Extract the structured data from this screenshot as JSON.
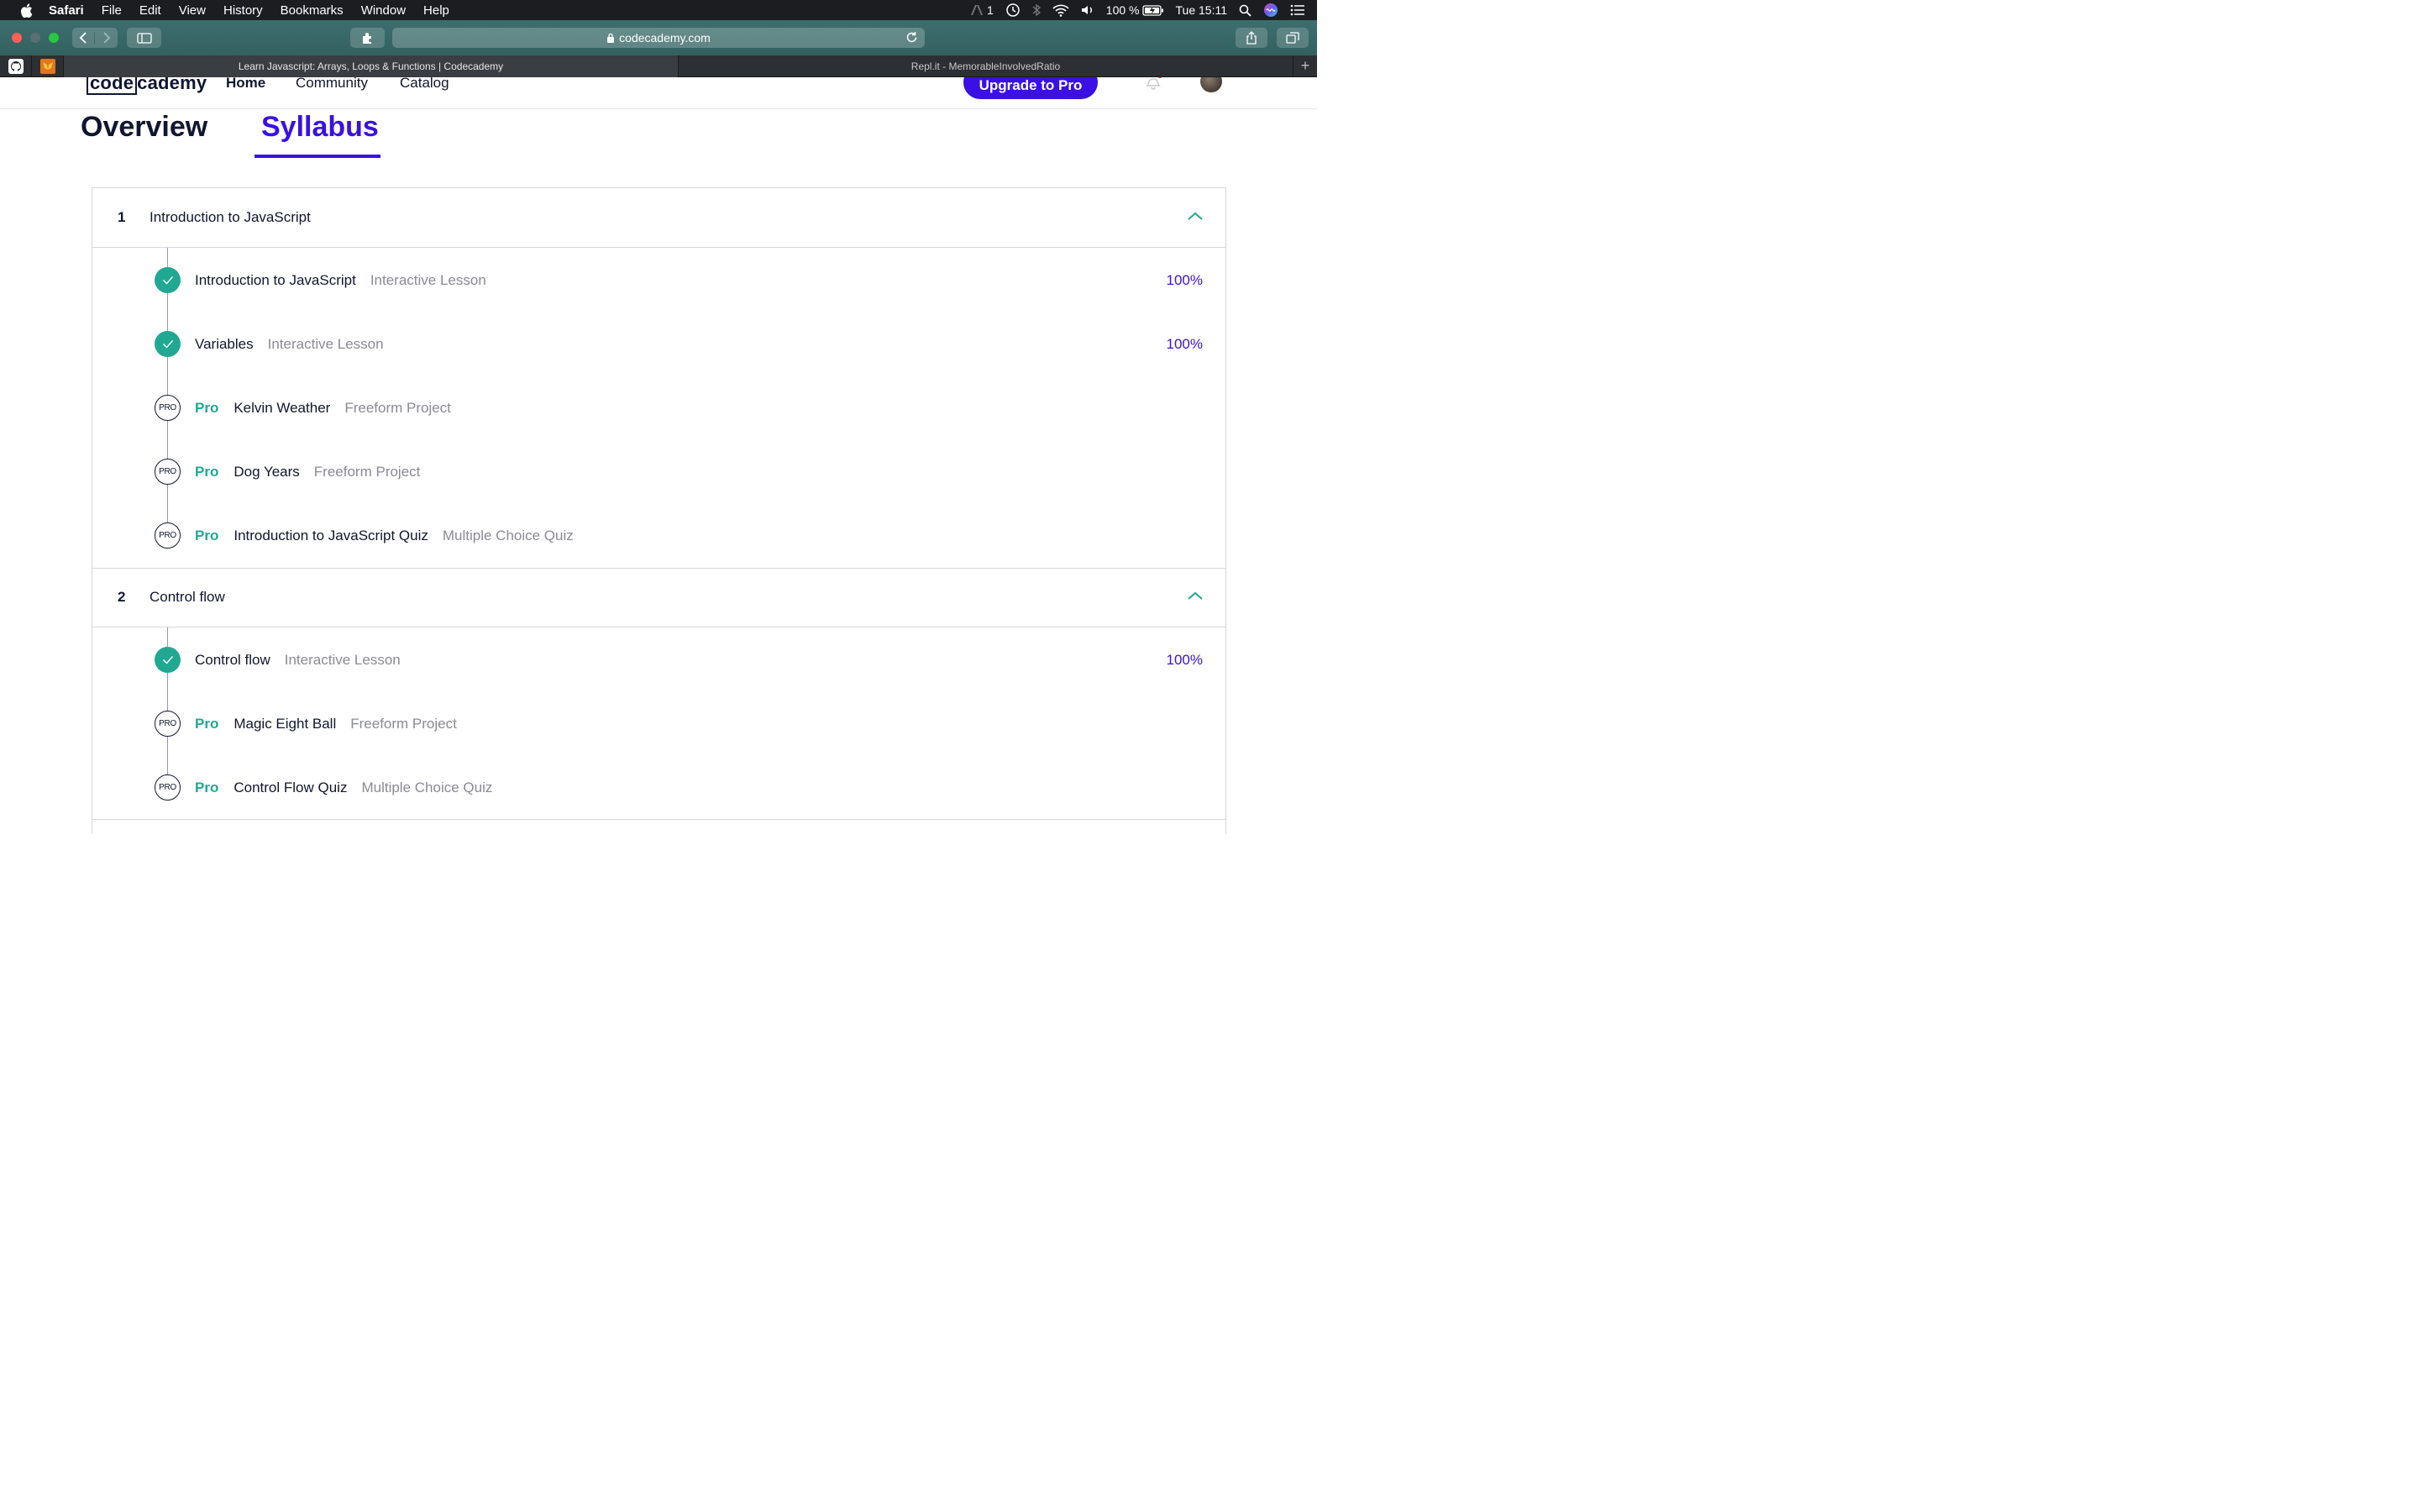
{
  "menubar": {
    "app": "Safari",
    "items": [
      "File",
      "Edit",
      "View",
      "History",
      "Bookmarks",
      "Window",
      "Help"
    ],
    "adobe_count": "1",
    "battery": "100 %",
    "clock": "Tue 15:11"
  },
  "browser": {
    "url": "codecademy.com",
    "tabs": [
      {
        "title": "Learn Javascript: Arrays, Loops & Functions | Codecademy"
      },
      {
        "title": "Repl.it - MemorableInvolvedRatio"
      }
    ],
    "new_tab": "+"
  },
  "site": {
    "logo_code": "code",
    "logo_academy": "cademy",
    "nav": {
      "home": "Home",
      "community": "Community",
      "catalog": "Catalog"
    },
    "upgrade": "Upgrade to Pro"
  },
  "page_tabs": {
    "overview": "Overview",
    "syllabus": "Syllabus"
  },
  "modules": [
    {
      "number": "1",
      "title": "Introduction to JavaScript",
      "lessons": [
        {
          "pro": "",
          "title": "Introduction to JavaScript",
          "type": "Interactive Lesson",
          "progress": "100%",
          "status": "done"
        },
        {
          "pro": "",
          "title": "Variables",
          "type": "Interactive Lesson",
          "progress": "100%",
          "status": "done"
        },
        {
          "pro": "Pro",
          "title": "Kelvin Weather",
          "type": "Freeform Project",
          "progress": "",
          "status": "pro",
          "badge": "PRO"
        },
        {
          "pro": "Pro",
          "title": "Dog Years",
          "type": "Freeform Project",
          "progress": "",
          "status": "pro",
          "badge": "PRO"
        },
        {
          "pro": "Pro",
          "title": "Introduction to JavaScript Quiz",
          "type": "Multiple Choice Quiz",
          "progress": "",
          "status": "pro",
          "badge": "PRO"
        }
      ]
    },
    {
      "number": "2",
      "title": "Control flow",
      "lessons": [
        {
          "pro": "",
          "title": "Control flow",
          "type": "Interactive Lesson",
          "progress": "100%",
          "status": "done"
        },
        {
          "pro": "Pro",
          "title": "Magic Eight Ball",
          "type": "Freeform Project",
          "progress": "",
          "status": "pro",
          "badge": "PRO"
        },
        {
          "pro": "Pro",
          "title": "Control Flow Quiz",
          "type": "Multiple Choice Quiz",
          "progress": "",
          "status": "pro",
          "badge": "PRO"
        }
      ]
    }
  ],
  "colors": {
    "accent": "#3a10e5",
    "success": "#21a893",
    "text": "#10162f",
    "muted": "#8a8a94"
  }
}
